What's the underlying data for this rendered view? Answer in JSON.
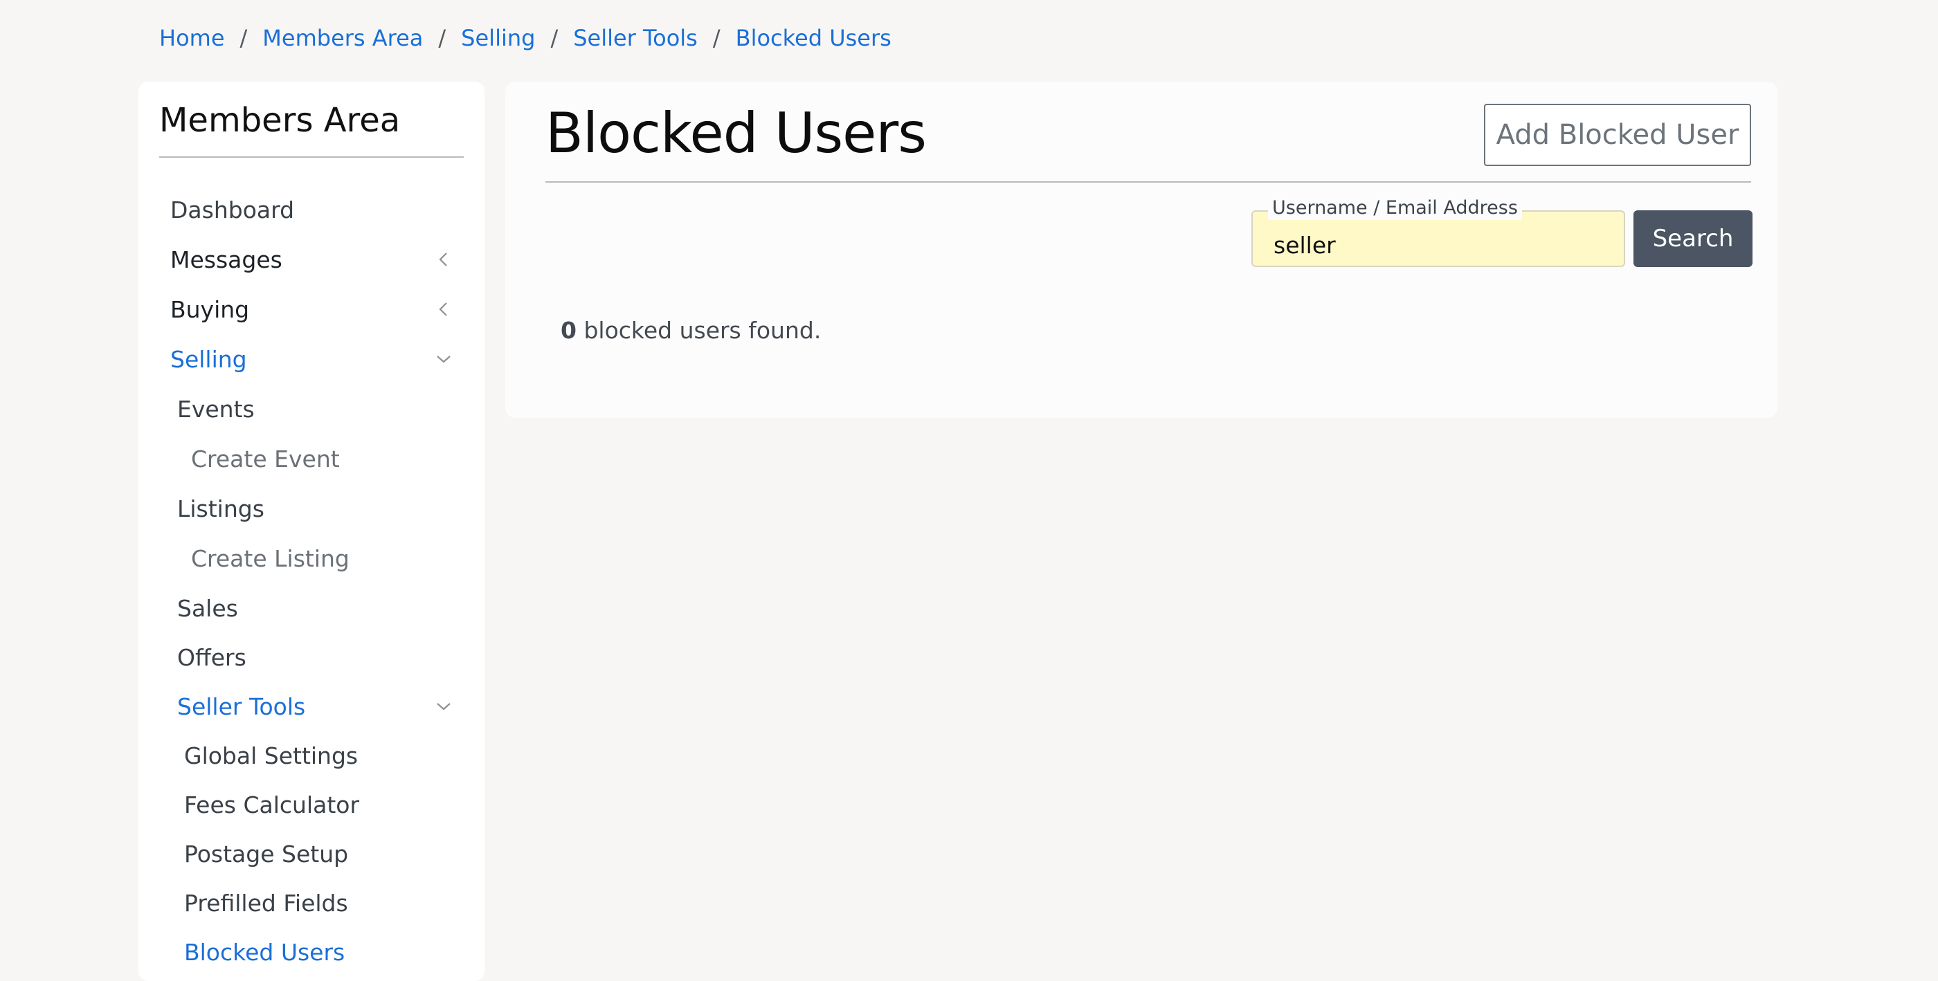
{
  "breadcrumb": {
    "items": [
      "Home",
      "Members Area",
      "Selling",
      "Seller Tools",
      "Blocked Users"
    ],
    "separator": "/"
  },
  "sidebar": {
    "title": "Members Area",
    "items": {
      "dashboard": "Dashboard",
      "messages": "Messages",
      "buying": "Buying",
      "selling": "Selling",
      "events": "Events",
      "create_event": "Create Event",
      "listings": "Listings",
      "create_listing": "Create Listing",
      "sales": "Sales",
      "offers": "Offers",
      "seller_tools": "Seller Tools",
      "global_settings": "Global Settings",
      "fees_calculator": "Fees Calculator",
      "postage_setup": "Postage Setup",
      "prefilled_fields": "Prefilled Fields",
      "blocked_users": "Blocked Users"
    },
    "icons": {
      "collapsed": "chevron-left-icon",
      "expanded": "chevron-down-icon"
    }
  },
  "main": {
    "title": "Blocked Users",
    "add_button": "Add Blocked User",
    "search": {
      "label": "Username / Email Address",
      "value": "seller",
      "button": "Search"
    },
    "results": {
      "count": "0",
      "text": " blocked users found."
    }
  },
  "colors": {
    "link": "#1a6fd8",
    "search_bg": "#fff9c7",
    "search_button": "#4b5563",
    "page_bg": "#f7f6f4"
  }
}
